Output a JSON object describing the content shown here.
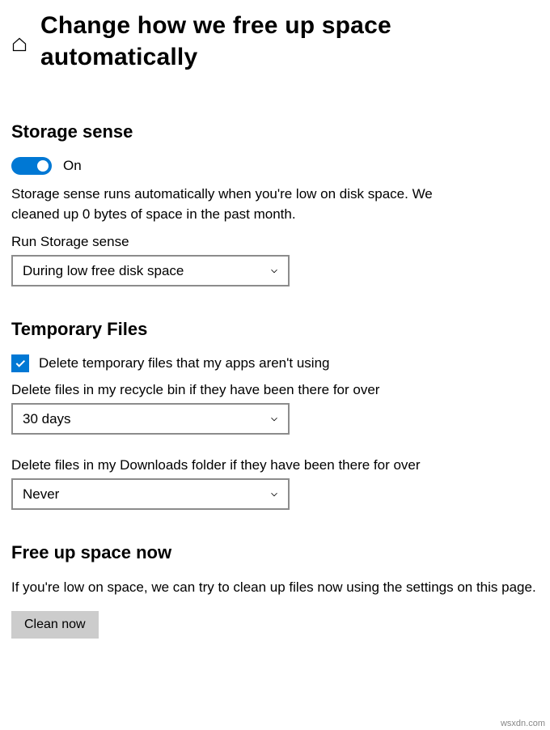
{
  "header": {
    "title": "Change how we free up space automatically"
  },
  "storageSense": {
    "heading": "Storage sense",
    "toggleLabel": "On",
    "description": "Storage sense runs automatically when you're low on disk space. We cleaned up 0 bytes of space in the past month.",
    "runLabel": "Run Storage sense",
    "runValue": "During low free disk space"
  },
  "temporaryFiles": {
    "heading": "Temporary Files",
    "deleteTempCheckbox": "Delete temporary files that my apps aren't using",
    "recycleBinLabel": "Delete files in my recycle bin if they have been there for over",
    "recycleBinValue": "30 days",
    "downloadsLabel": "Delete files in my Downloads folder if they have been there for over",
    "downloadsValue": "Never"
  },
  "freeUpSpace": {
    "heading": "Free up space now",
    "description": "If you're low on space, we can try to clean up files now using the settings on this page.",
    "buttonLabel": "Clean now"
  },
  "watermark": "wsxdn.com"
}
